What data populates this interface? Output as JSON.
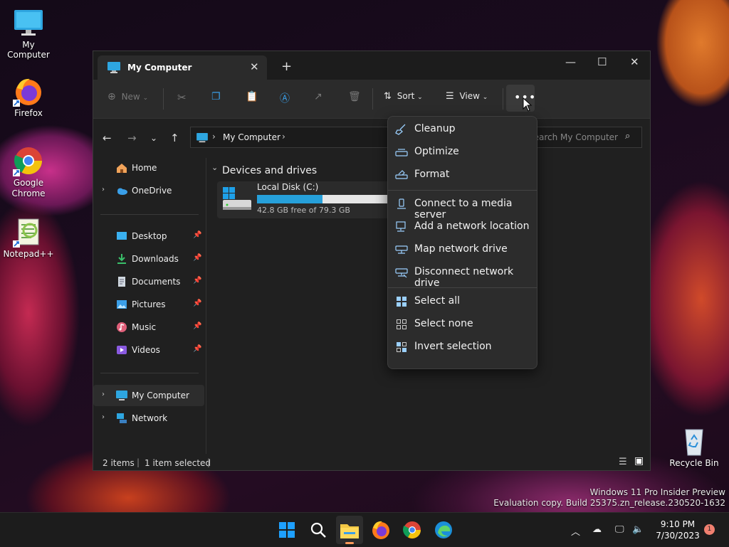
{
  "desktop": {
    "icons": [
      {
        "label": "My Computer"
      },
      {
        "label": "Firefox"
      },
      {
        "label": "Google Chrome"
      },
      {
        "label": "Notepad++"
      },
      {
        "label": "Recycle Bin"
      }
    ],
    "watermark": {
      "line1": "Windows 11 Pro Insider Preview",
      "line2": "Evaluation copy. Build 25375.zn_release.230520-1632"
    }
  },
  "explorer": {
    "tab_title": "My Computer",
    "toolbar": {
      "new_label": "New",
      "sort_label": "Sort",
      "view_label": "View"
    },
    "address": {
      "root_label": "My Computer"
    },
    "search": {
      "placeholder": "Search My Computer"
    },
    "sidebar": {
      "items": [
        {
          "label": "Home"
        },
        {
          "label": "OneDrive"
        },
        {
          "label": "Desktop"
        },
        {
          "label": "Downloads"
        },
        {
          "label": "Documents"
        },
        {
          "label": "Pictures"
        },
        {
          "label": "Music"
        },
        {
          "label": "Videos"
        },
        {
          "label": "My Computer"
        },
        {
          "label": "Network"
        }
      ]
    },
    "section_title": "Devices and drives",
    "drive": {
      "name": "Local Disk (C:)",
      "free_text": "42.8 GB free of 79.3 GB",
      "used_fraction": 0.46
    },
    "status": {
      "items": "2 items",
      "selected": "1 item selected"
    }
  },
  "context_menu": {
    "items": [
      {
        "label": "Cleanup"
      },
      {
        "label": "Optimize"
      },
      {
        "label": "Format"
      },
      {
        "label": "Connect to a media server"
      },
      {
        "label": "Add a network location"
      },
      {
        "label": "Map network drive"
      },
      {
        "label": "Disconnect network drive"
      },
      {
        "label": "Select all"
      },
      {
        "label": "Select none"
      },
      {
        "label": "Invert selection"
      }
    ]
  },
  "taskbar": {
    "time": "9:10 PM",
    "date": "7/30/2023",
    "notification_count": "1",
    "accent": "#0a84ff"
  }
}
